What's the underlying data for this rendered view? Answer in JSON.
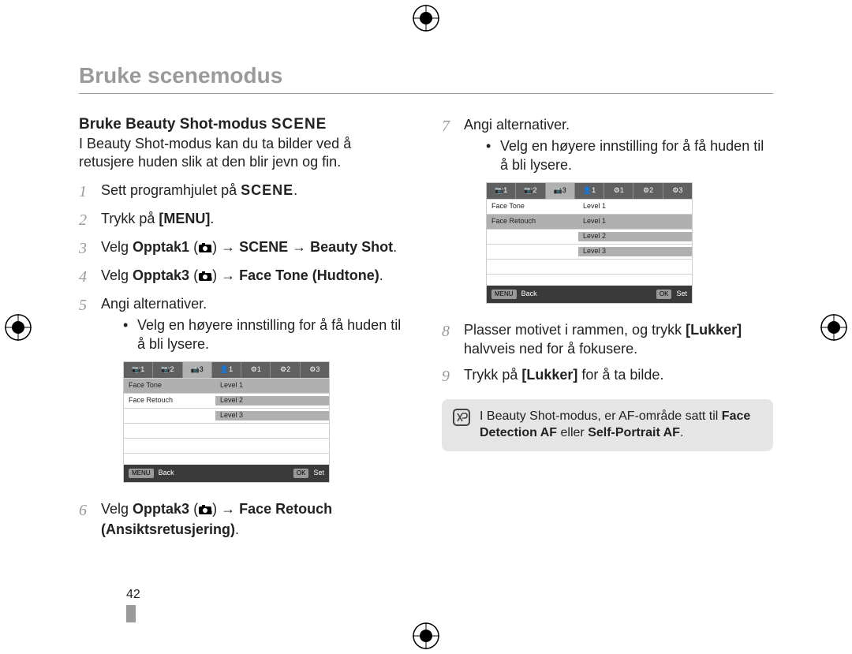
{
  "running_head": "Bruke scenemodus",
  "section": {
    "title": "Bruke Beauty Shot-modus",
    "title_badge": "SCENE",
    "intro": "I Beauty Shot-modus kan du ta bilder ved å retusjere huden slik at den blir jevn og fin."
  },
  "scene_word": "SCENE",
  "steps": {
    "s1_a": "Sett programhjulet på ",
    "s1_b": ".",
    "s2_a": "Trykk på ",
    "s2_b": "[MENU]",
    "s2_c": ".",
    "s3_a": "Velg ",
    "s3_b": "Opptak1",
    "s3_c": " (",
    "s3_d": ") → ",
    "s3_e": "SCENE",
    "s3_f": " → ",
    "s3_g": "Beauty Shot",
    "s3_h": ".",
    "s4_a": "Velg ",
    "s4_b": "Opptak3",
    "s4_c": " (",
    "s4_d": ") → ",
    "s4_e": "Face Tone (Hudtone)",
    "s4_f": ".",
    "s5": "Angi alternativer.",
    "s5_bullet": "Velg en høyere innstilling for å få huden til å bli lysere.",
    "s6_a": "Velg ",
    "s6_b": "Opptak3",
    "s6_c": " (",
    "s6_d": ") → ",
    "s6_e": "Face Retouch (Ansiktsretusjering)",
    "s6_f": ".",
    "s7": "Angi alternativer.",
    "s7_bullet": "Velg en høyere innstilling for å få huden til å bli lysere.",
    "s8_a": "Plasser motivet i rammen, og trykk ",
    "s8_b": "[Lukker]",
    "s8_c": " halvveis ned for å fokusere.",
    "s9_a": "Trykk på ",
    "s9_b": "[Lukker]",
    "s9_c": " for å ta bilde."
  },
  "lcd1": {
    "tabs": [
      "1",
      "2",
      "3",
      "1",
      "1",
      "2",
      "3"
    ],
    "rows": {
      "r1_label": "Face Tone",
      "r1_val": "Level 1",
      "r2_label": "Face Retouch",
      "r2_val": "Level 2",
      "r3_val": "Level 3"
    },
    "bar": {
      "back_key": "MENU",
      "back": "Back",
      "ok_key": "OK",
      "set": "Set"
    }
  },
  "lcd2": {
    "tabs": [
      "1",
      "2",
      "3",
      "1",
      "1",
      "2",
      "3"
    ],
    "rows": {
      "r1_label": "Face Tone",
      "r1_val": "Level 1",
      "r2_label": "Face Retouch",
      "r2_val": "Level 1",
      "r3_val": "Level 2",
      "r4_val": "Level 3"
    },
    "bar": {
      "back_key": "MENU",
      "back": "Back",
      "ok_key": "OK",
      "set": "Set"
    }
  },
  "note": {
    "line1": "I Beauty Shot-modus, er AF-område satt til ",
    "line2a": "Face Detection AF",
    "line2b": " eller ",
    "line2c": "Self-Portrait AF",
    "line2d": "."
  },
  "page_number": "42"
}
